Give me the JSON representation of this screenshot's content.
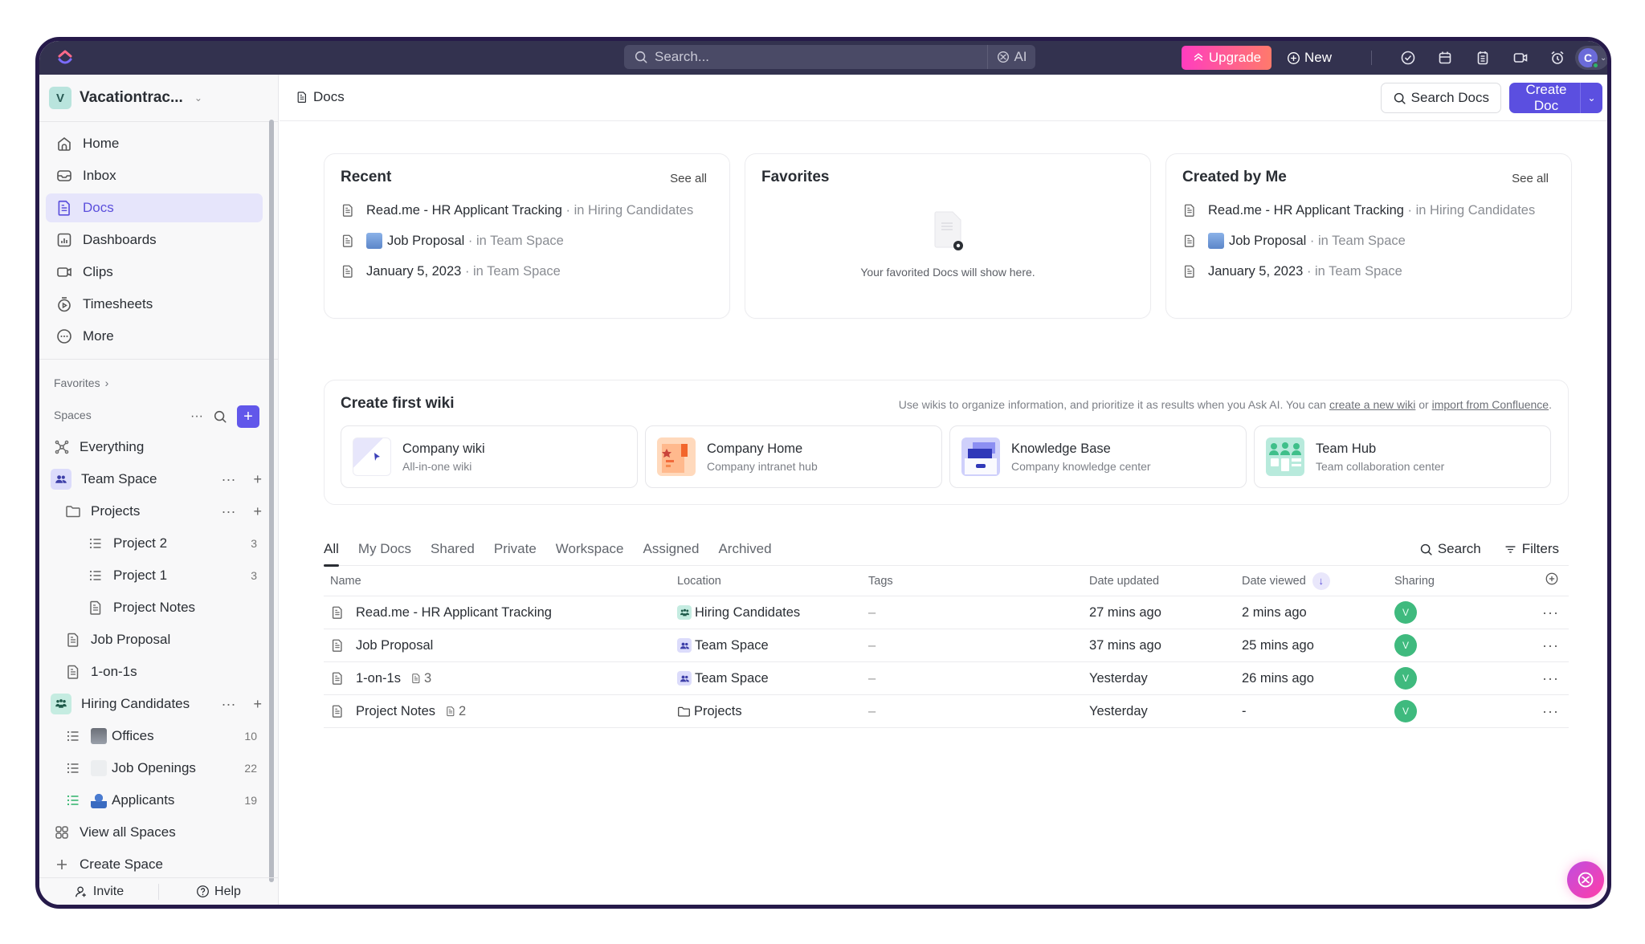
{
  "topbar": {
    "search_placeholder": "Search...",
    "ai_label": "AI",
    "upgrade_label": "Upgrade",
    "new_label": "New",
    "icons": [
      "check-circle-icon",
      "calendar-icon",
      "notepad-icon",
      "video-icon",
      "alarm-clock-icon",
      "apps-grid-icon"
    ],
    "avatar_initial": "C"
  },
  "sidebar": {
    "workspace_initial": "V",
    "workspace_name": "Vacationtrac...",
    "nav": [
      {
        "label": "Home",
        "icon": "home-icon"
      },
      {
        "label": "Inbox",
        "icon": "inbox-icon"
      },
      {
        "label": "Docs",
        "icon": "doc-icon",
        "active": true
      },
      {
        "label": "Dashboards",
        "icon": "dashboard-icon"
      },
      {
        "label": "Clips",
        "icon": "video-icon"
      },
      {
        "label": "Timesheets",
        "icon": "timer-icon"
      },
      {
        "label": "More",
        "icon": "more-circle-icon"
      }
    ],
    "favorites_label": "Favorites",
    "spaces_label": "Spaces",
    "tree": [
      {
        "label": "Everything",
        "icon": "everything-icon"
      },
      {
        "label": "Team Space",
        "icon": "team-space-icon"
      },
      {
        "label": "Projects",
        "icon": "folder-icon"
      },
      {
        "label": "Project 2",
        "icon": "list-icon",
        "count": "3"
      },
      {
        "label": "Project 1",
        "icon": "list-icon",
        "count": "3"
      },
      {
        "label": "Project Notes",
        "icon": "doc-icon"
      },
      {
        "label": "Job Proposal",
        "icon": "doc-icon"
      },
      {
        "label": "1-on-1s",
        "icon": "doc-icon"
      },
      {
        "label": "Hiring Candidates",
        "icon": "hiring-space-icon"
      },
      {
        "label": "Offices",
        "icon": "list-icon",
        "count": "10"
      },
      {
        "label": "Job Openings",
        "icon": "list-icon",
        "count": "22"
      },
      {
        "label": "Applicants",
        "icon": "list-icon",
        "count": "19"
      },
      {
        "label": "View all Spaces",
        "icon": "grid-icon"
      },
      {
        "label": "Create Space",
        "icon": "plus-icon"
      }
    ],
    "footer": {
      "invite": "Invite",
      "help": "Help"
    }
  },
  "header": {
    "breadcrumb": "Docs",
    "search_docs": "Search Docs",
    "create_doc": "Create Doc"
  },
  "cards": {
    "recent": {
      "title": "Recent",
      "see_all": "See all",
      "items": [
        {
          "name": "Read.me - HR Applicant Tracking",
          "loc": "· in Hiring Candidates"
        },
        {
          "name": "Job Proposal",
          "loc": "· in Team Space",
          "emoji": true
        },
        {
          "name": "January 5, 2023",
          "loc": "· in Team Space"
        }
      ]
    },
    "favorites": {
      "title": "Favorites",
      "empty": "Your favorited Docs will show here."
    },
    "created": {
      "title": "Created by Me",
      "see_all": "See all",
      "items": [
        {
          "name": "Read.me - HR Applicant Tracking",
          "loc": "· in Hiring Candidates"
        },
        {
          "name": "Job Proposal",
          "loc": "· in Team Space",
          "emoji": true
        },
        {
          "name": "January 5, 2023",
          "loc": "· in Team Space"
        }
      ]
    }
  },
  "wiki": {
    "title": "Create first wiki",
    "hint_prefix": "Use wikis to organize information, and prioritize it as results when you Ask AI. You can ",
    "hint_link1": "create a new wiki",
    "hint_mid": " or ",
    "hint_link2": "import from Confluence",
    "hint_suffix": ".",
    "templates": [
      {
        "title": "Company wiki",
        "subtitle": "All-in-one wiki"
      },
      {
        "title": "Company Home",
        "subtitle": "Company intranet hub"
      },
      {
        "title": "Knowledge Base",
        "subtitle": "Company knowledge center"
      },
      {
        "title": "Team Hub",
        "subtitle": "Team collaboration center"
      }
    ]
  },
  "tabs": [
    "All",
    "My Docs",
    "Shared",
    "Private",
    "Workspace",
    "Assigned",
    "Archived"
  ],
  "active_tab": "All",
  "tab_tools": {
    "search": "Search",
    "filters": "Filters"
  },
  "table": {
    "columns": {
      "name": "Name",
      "location": "Location",
      "tags": "Tags",
      "date_updated": "Date updated",
      "date_viewed": "Date viewed",
      "sharing": "Sharing"
    },
    "rows": [
      {
        "name": "Read.me - HR Applicant Tracking",
        "sub": "",
        "location": "Hiring Candidates",
        "loc_icon": "hiring",
        "tags": "–",
        "updated": "27 mins ago",
        "viewed": "2 mins ago",
        "share": "V"
      },
      {
        "name": "Job Proposal",
        "sub": "",
        "location": "Team Space",
        "loc_icon": "team",
        "tags": "–",
        "updated": "37 mins ago",
        "viewed": "25 mins ago",
        "share": "V"
      },
      {
        "name": "1-on-1s",
        "sub": "3",
        "location": "Team Space",
        "loc_icon": "team",
        "tags": "–",
        "updated": "Yesterday",
        "viewed": "26 mins ago",
        "share": "V"
      },
      {
        "name": "Project Notes",
        "sub": "2",
        "location": "Projects",
        "loc_icon": "folder",
        "tags": "–",
        "updated": "Yesterday",
        "viewed": "-",
        "share": "V"
      }
    ]
  },
  "colors": {
    "accent": "#5b4fe0",
    "topbar": "#33324f",
    "frame": "#261a4a",
    "share_avatar": "#3fba7e"
  }
}
